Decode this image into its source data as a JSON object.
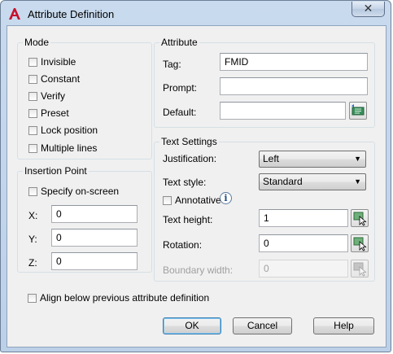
{
  "window": {
    "title": "Attribute Definition",
    "close_glyph": "✕"
  },
  "mode": {
    "title": "Mode",
    "options": [
      {
        "label": "Invisible",
        "checked": false
      },
      {
        "label": "Constant",
        "checked": false
      },
      {
        "label": "Verify",
        "checked": false
      },
      {
        "label": "Preset",
        "checked": false
      },
      {
        "label": "Lock position",
        "checked": false
      },
      {
        "label": "Multiple lines",
        "checked": false
      }
    ]
  },
  "attribute": {
    "title": "Attribute",
    "tag_label": "Tag:",
    "tag_value": "FMID",
    "prompt_label": "Prompt:",
    "prompt_value": "",
    "default_label": "Default:",
    "default_value": ""
  },
  "insertion": {
    "title": "Insertion Point",
    "specify_label": "Specify on-screen",
    "specify_checked": false,
    "x_label": "X:",
    "x_value": "0",
    "y_label": "Y:",
    "y_value": "0",
    "z_label": "Z:",
    "z_value": "0"
  },
  "text_settings": {
    "title": "Text Settings",
    "justification_label": "Justification:",
    "justification_value": "Left",
    "style_label": "Text style:",
    "style_value": "Standard",
    "annotative_label": "Annotative",
    "annotative_checked": false,
    "height_label": "Text height:",
    "height_value": "1",
    "rotation_label": "Rotation:",
    "rotation_value": "0",
    "boundary_label": "Boundary width:",
    "boundary_value": "0"
  },
  "align_label": "Align below previous attribute definition",
  "buttons": {
    "ok": "OK",
    "cancel": "Cancel",
    "help": "Help"
  },
  "colors": {
    "accent": "#3c7fb1",
    "title_bg": "#c9daee",
    "client_bg": "#f0f0f0"
  }
}
